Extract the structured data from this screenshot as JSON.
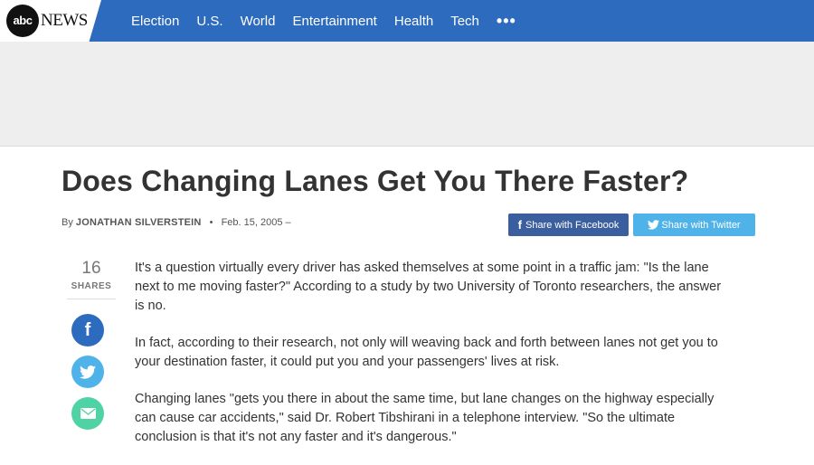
{
  "brand": {
    "logo_circle": "abc",
    "logo_text": "NEWS"
  },
  "nav": {
    "items": [
      "Election",
      "U.S.",
      "World",
      "Entertainment",
      "Health",
      "Tech"
    ],
    "more": "•••"
  },
  "article": {
    "headline": "Does Changing Lanes Get You There Faster?",
    "byline_prefix": "By",
    "author": "JONATHAN SILVERSTEIN",
    "separator": "•",
    "date": "Feb. 15, 2005 –",
    "paragraphs": [
      "It's a question virtually every driver has asked themselves at some point in a traffic jam: \"Is the lane next to me moving faster?\" According to a study by two University of Toronto researchers, the answer is no.",
      "In fact, according to their research, not only will weaving back and forth between lanes not get you to your destination faster, it could put you and your passengers' lives at risk.",
      "Changing lanes \"gets you there in about the same time, but lane changes on the highway especially can cause car accidents,\" said Dr. Robert Tibshirani in a telephone interview. \"So the ultimate conclusion is that it's not any faster and it's dangerous.\""
    ]
  },
  "share": {
    "facebook_label": "Share with Facebook",
    "twitter_label": "Share with Twitter",
    "count": "16",
    "count_label": "SHARES"
  },
  "colors": {
    "nav_bg": "#2d6bbf",
    "facebook": "#3b5e9e",
    "twitter": "#4fb3ea",
    "email": "#4fd3a5"
  }
}
